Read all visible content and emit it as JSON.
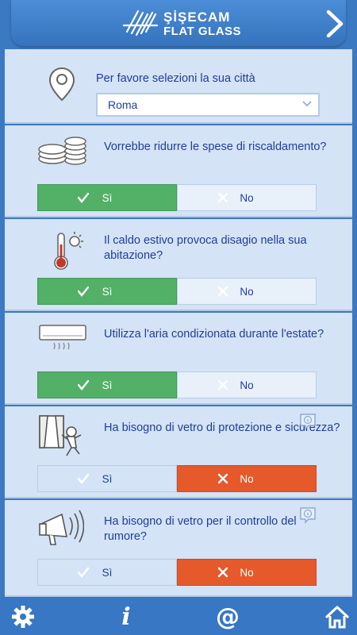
{
  "header": {
    "brand_line1": "ŞİŞECAM",
    "brand_line2": "FLAT GLASS",
    "next_icon": "chevron-right-icon"
  },
  "city": {
    "question": "Per favore selezioni la sua città",
    "selected": "Roma",
    "icon": "location-pin-icon"
  },
  "questions": [
    {
      "text": "Vorrebbe ridurre le spese di riscaldamento?",
      "icon": "coins-icon",
      "yes_label": "Sì",
      "no_label": "No",
      "answer": "yes"
    },
    {
      "text": "Il caldo estivo provoca disagio nella sua abitazione?",
      "icon": "thermometer-sun-icon",
      "yes_label": "Sì",
      "no_label": "No",
      "answer": "yes"
    },
    {
      "text": "Utilizza l'aria condizionata durante l'estate?",
      "icon": "air-conditioner-icon",
      "yes_label": "Sì",
      "no_label": "No",
      "answer": "yes"
    },
    {
      "text": "Ha bisogno di vetro di protezione e sicurezza?",
      "icon": "burglar-window-icon",
      "yes_label": "Sì",
      "no_label": "No",
      "answer": "no"
    },
    {
      "text": "Ha bisogno di vetro per il controllo del rumore?",
      "icon": "megaphone-icon",
      "yes_label": "Sì",
      "no_label": "No",
      "answer": "no"
    }
  ],
  "colors": {
    "yes_active": "#52b067",
    "no_active": "#e5592a",
    "text": "#1f3f99",
    "bar": "#3777c3"
  },
  "bottom_bar": {
    "icons": [
      "gear-icon",
      "info-icon",
      "at-icon",
      "home-icon"
    ]
  }
}
